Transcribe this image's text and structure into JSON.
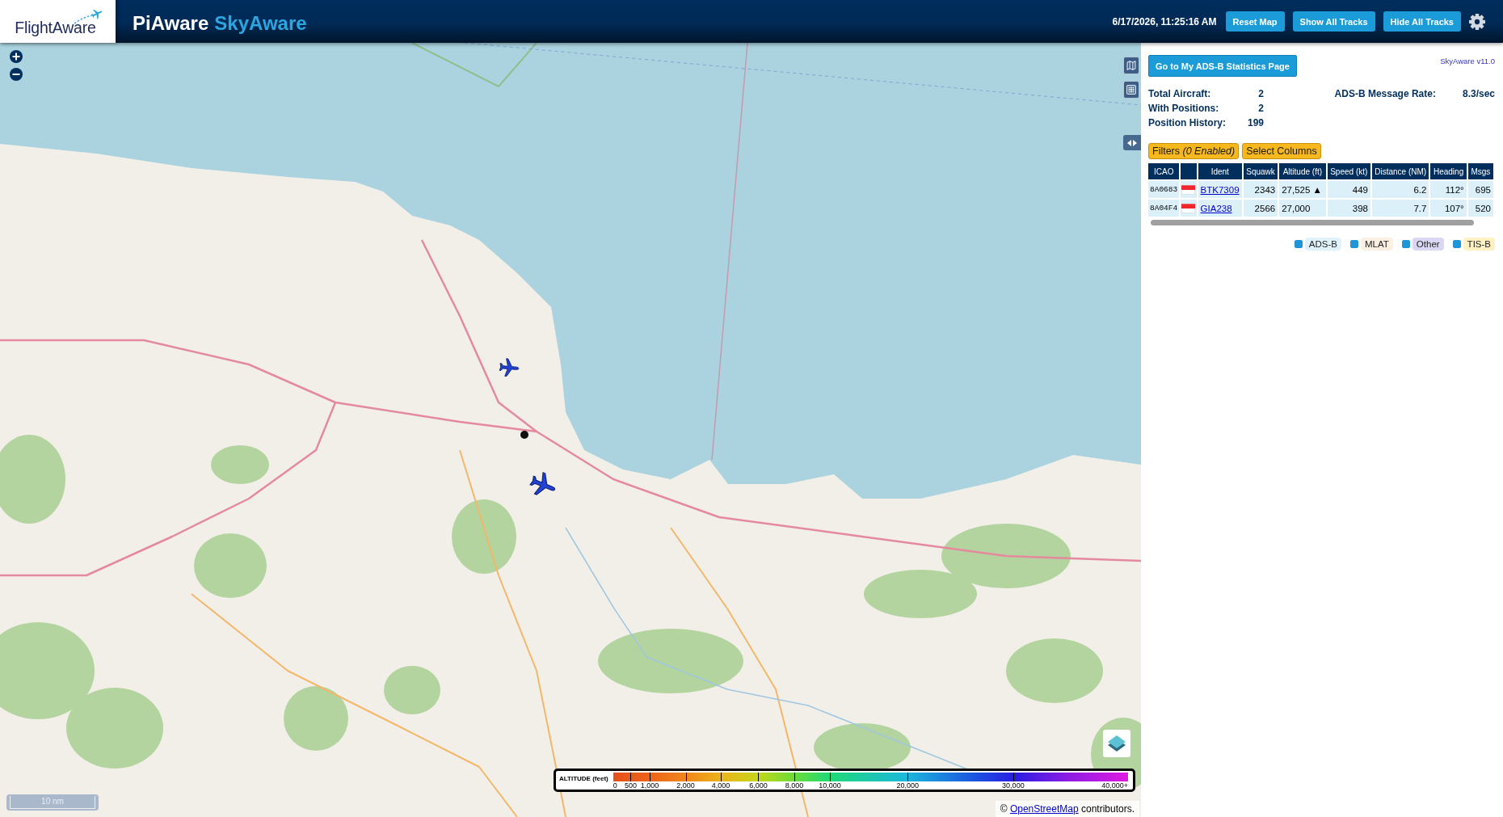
{
  "header": {
    "logo": "FlightAware",
    "title": "PiAware",
    "subtitle": "SkyAware",
    "clock": "6/17/2026, 11:25:16 AM",
    "buttons": [
      "Reset Map",
      "Show All Tracks",
      "Hide All Tracks"
    ]
  },
  "map": {
    "scale": "10 nm",
    "altitude_legend": {
      "title": "ALTITUDE (feet)",
      "ticks": [
        "0",
        "500",
        "1,000",
        "2,000",
        "4,000",
        "6,000",
        "8,000",
        "10,000",
        "20,000",
        "30,000",
        "40,000+"
      ]
    },
    "attribution": {
      "prefix": "©",
      "link": "OpenStreetMap",
      "suffix": "contributors."
    }
  },
  "panel": {
    "stats_button": "Go to My ADS-B Statistics Page",
    "version": "SkyAware v11.0",
    "stats": [
      {
        "label": "Total Aircraft:",
        "value": "2"
      },
      {
        "label": "With Positions:",
        "value": "2"
      },
      {
        "label": "Position History:",
        "value": "199"
      }
    ],
    "message_rate": {
      "label": "ADS-B Message Rate:",
      "value": "8.3/sec"
    },
    "filters_button": "Filters *(0 Enabled)*",
    "columns_button": "Select Columns",
    "table": {
      "columns": {
        "icao": "ICAO",
        "ident": "Ident",
        "data": [
          "Squawk",
          "Altitude (ft)",
          "Speed (kt)",
          "Distance (NM)",
          "Heading",
          "Msgs"
        ]
      },
      "rows": [
        {
          "icao": "8A0683",
          "ident": "BTK7309",
          "data": [
            "2343",
            "27,525 ▲",
            "449",
            "6.2",
            "112°",
            "695"
          ]
        },
        {
          "icao": "8A04F4",
          "ident": "GIA238",
          "data": [
            "2566",
            "27,000",
            "398",
            "7.7",
            "107°",
            "520"
          ]
        }
      ]
    },
    "legend": [
      {
        "label": "ADS-B",
        "color": "#e0f3fc",
        "checked": true
      },
      {
        "label": "MLAT",
        "color": "#fcf0e2",
        "checked": true
      },
      {
        "label": "Other",
        "color": "#dad7f5",
        "checked": true
      },
      {
        "label": "TIS-B",
        "color": "#fff1c2",
        "checked": true
      }
    ]
  }
}
